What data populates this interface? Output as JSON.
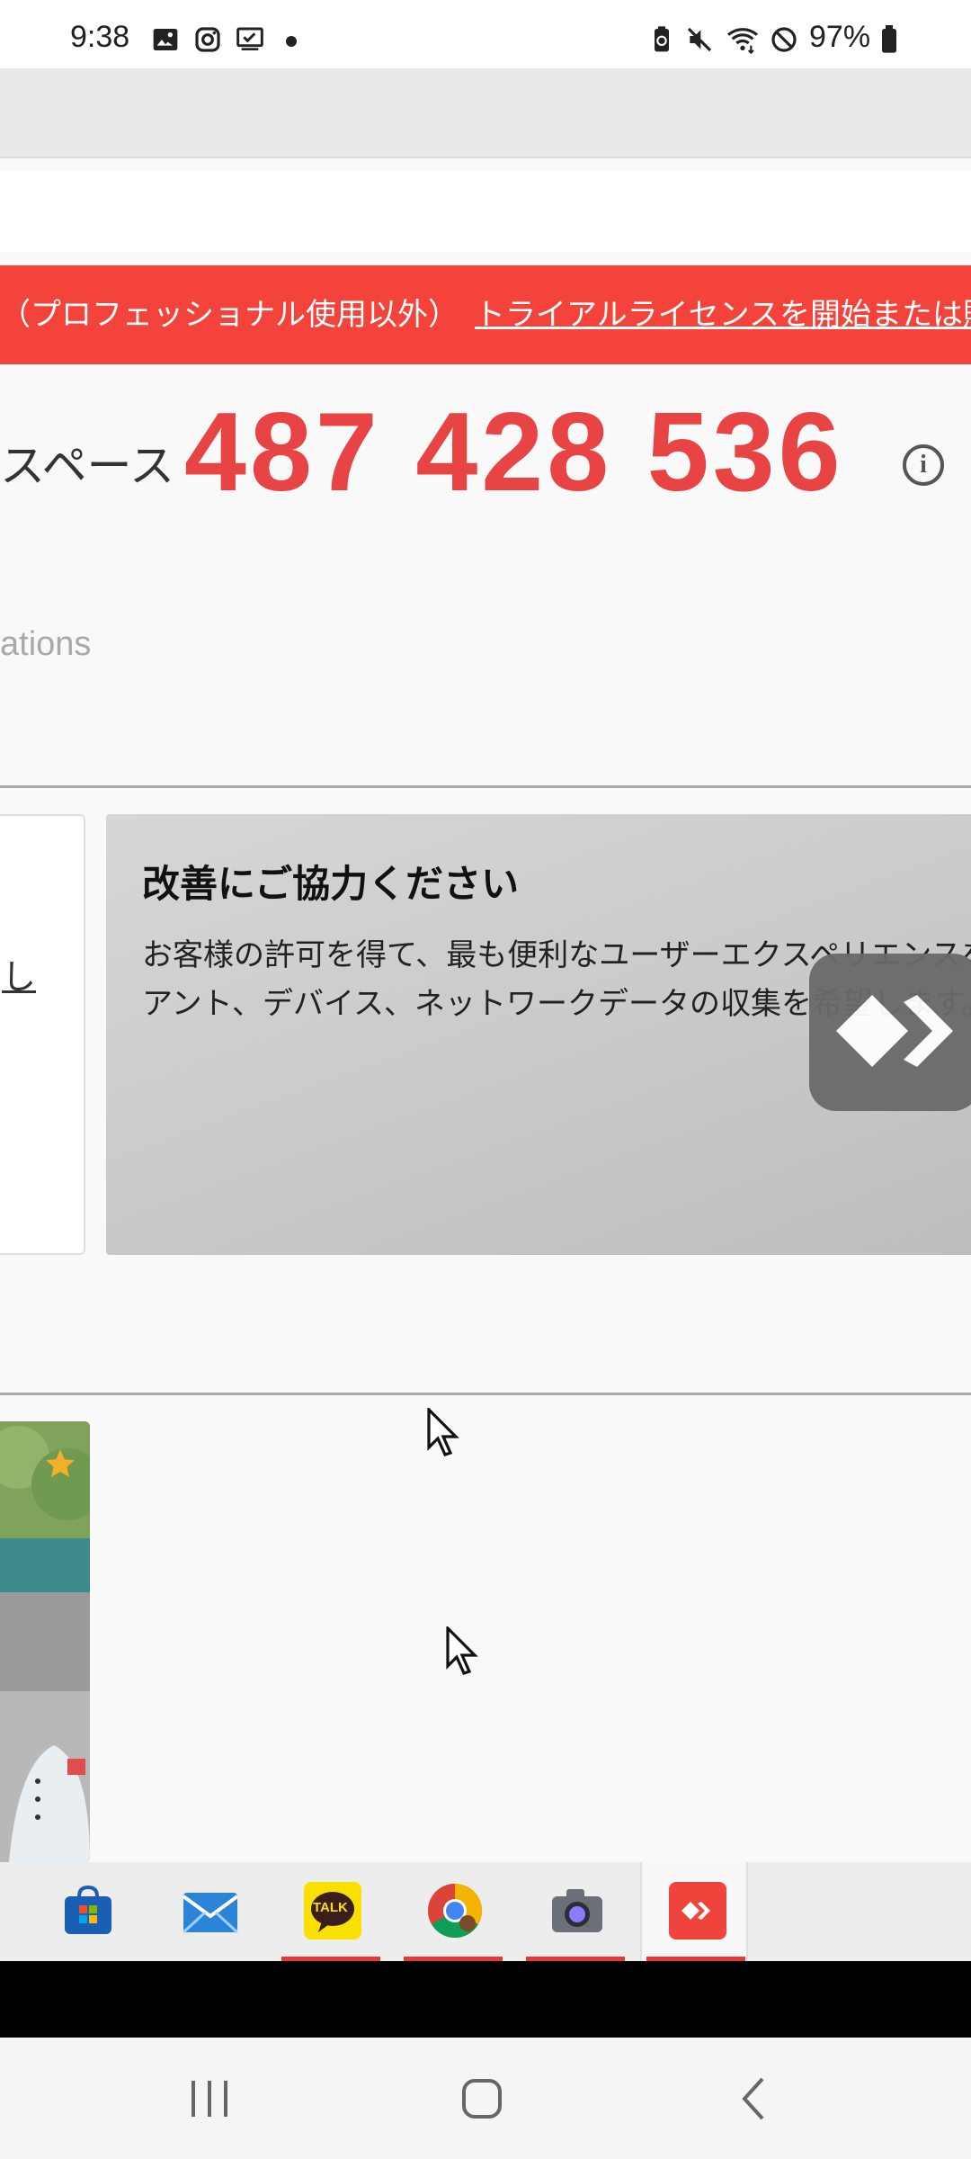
{
  "status_bar": {
    "time": "9:38",
    "battery": "97%",
    "left_icons": [
      "gallery-icon",
      "instagram-icon",
      "task-icon",
      "dot-icon"
    ],
    "right_icons": [
      "battery-saver-icon",
      "mute-icon",
      "wifi-icon",
      "block-icon",
      "battery-icon"
    ]
  },
  "banner": {
    "text": "（プロフェッショナル使用以外）",
    "link": "トライアルライセンスを開始または購入"
  },
  "address": {
    "label": "スペース",
    "id": "487 428 536"
  },
  "section": {
    "partial_text": "ations"
  },
  "left_card": {
    "fragment": "し"
  },
  "help_card": {
    "title": "改善にご協力ください",
    "description": "お客様の許可を得て、最も便利なユーザーエクスペリエンスを提\nアント、デバイス、ネットワークデータの収集を希望します。"
  },
  "taskbar": {
    "items": [
      "store",
      "mail",
      "kakaotalk",
      "chrome",
      "camera",
      "anydesk"
    ],
    "kakao_label": "TALK"
  },
  "colors": {
    "accent": "#f4433a",
    "id_color": "#e84444",
    "taskbar_running": "#e53935"
  }
}
